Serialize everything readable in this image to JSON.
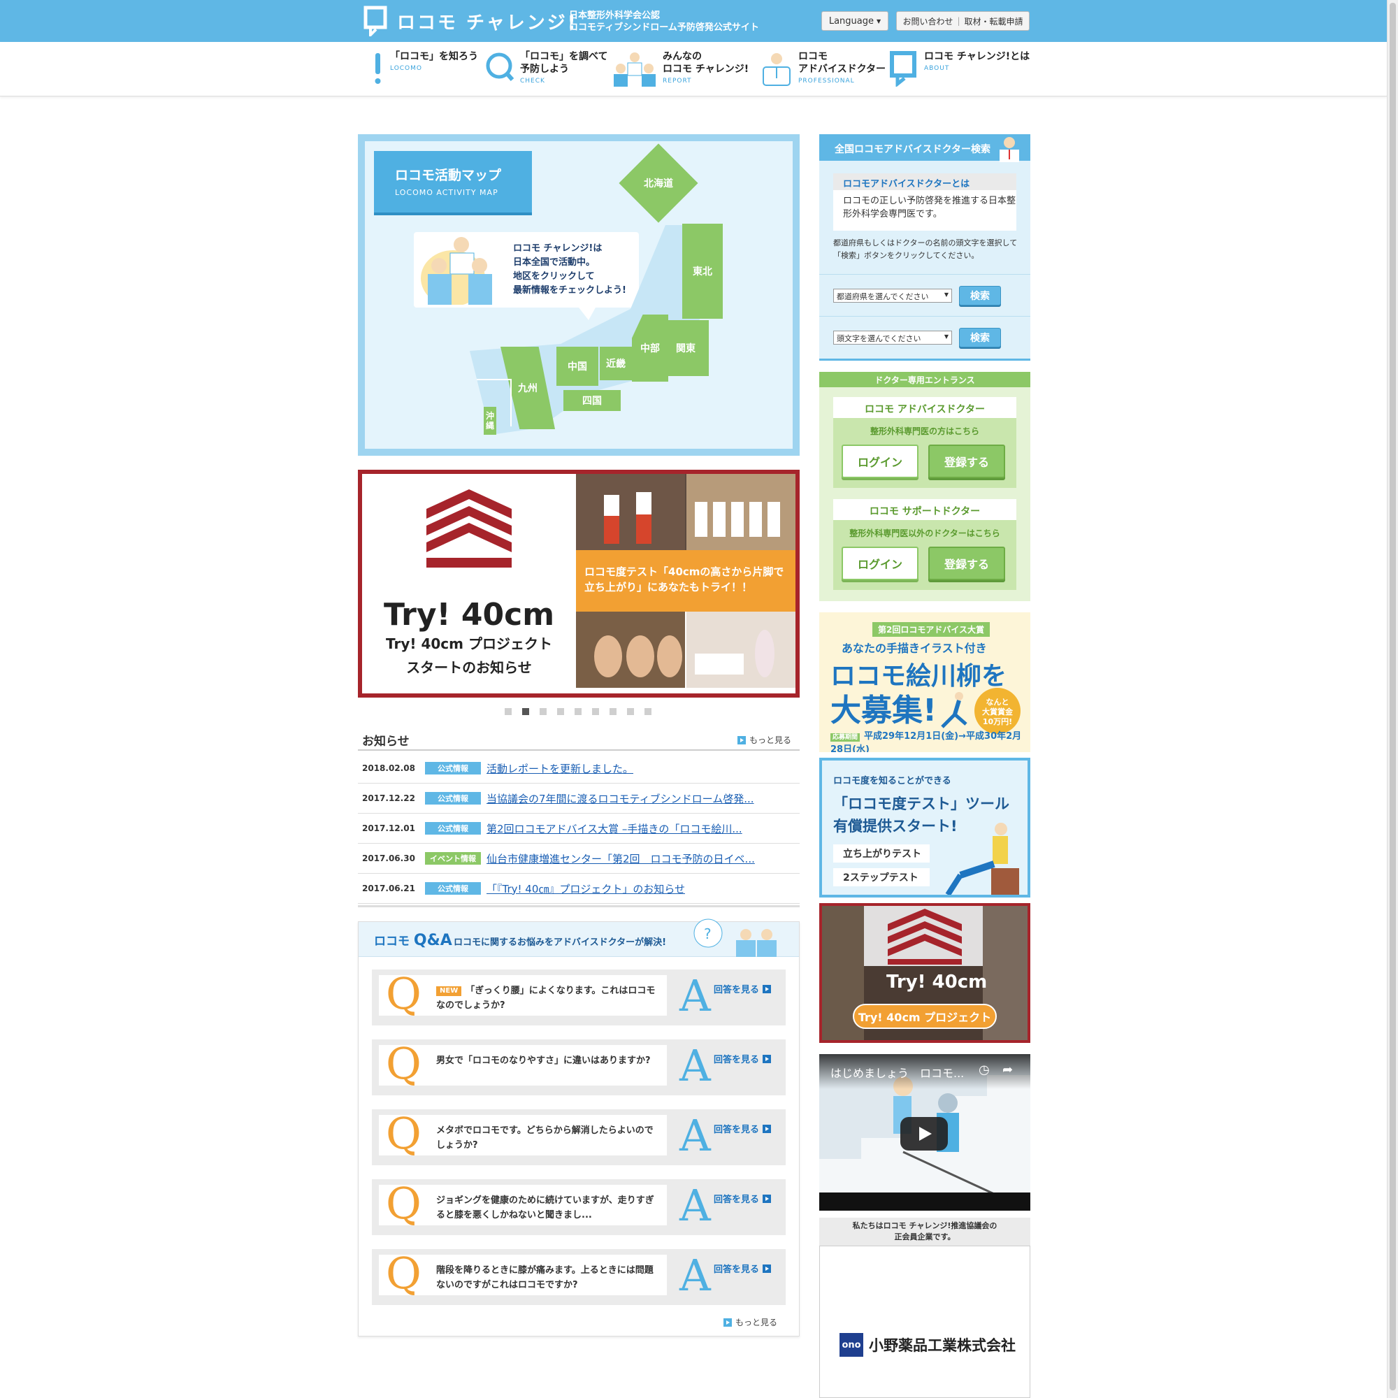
{
  "header": {
    "logo_text": "ロコモ チャレンジ!",
    "tagline_1": "日本整形外科学会公認",
    "tagline_2": "ロコモティブシンドローム予防啓発公式サイト",
    "language_label": "Language",
    "contact_label": "お問い合わせ",
    "press_label": "取材・転載申請"
  },
  "nav": [
    {
      "label": "「ロコモ」を知ろう",
      "sub": "LOCOMO"
    },
    {
      "label": "「ロコモ」を調べて\n予防しよう",
      "sub": "CHECK"
    },
    {
      "label": "みんなの\nロコモ チャレンジ!",
      "sub": "REPORT"
    },
    {
      "label": "ロコモ\nアドバイスドクター",
      "sub": "PROFESSIONAL"
    },
    {
      "label": "ロコモ チャレンジ!とは",
      "sub": "ABOUT"
    }
  ],
  "map": {
    "title": "ロコモ活動マップ",
    "subtitle": "LOCOMO ACTIVITY MAP",
    "speech": "ロコモ チャレンジ!は\n日本全国で活動中。\n地区をクリックして\n最新情報をチェックしよう!",
    "regions": {
      "hokkaido": "北海道",
      "tohoku": "東北",
      "kanto": "関東",
      "chubu": "中部",
      "kinki": "近畿",
      "chugoku": "中国",
      "shikoku": "四国",
      "kyushu": "九州",
      "okinawa": "沖縄"
    }
  },
  "slider": {
    "title": "Try! 40cm",
    "subtitle": "Try! 40cm プロジェクト\nスタートのお知らせ",
    "caption": "ロコモ度テスト「40cmの高さから片脚で\n立ち上がり」にあなたもトライ！！",
    "active_index": 1,
    "dot_count": 9
  },
  "news": {
    "title": "お知らせ",
    "more": "もっと見る",
    "items": [
      {
        "date": "2018.02.08",
        "tag": "公式情報",
        "tag_color": "#5fb7e5",
        "text": "活動レポートを更新しました。"
      },
      {
        "date": "2017.12.22",
        "tag": "公式情報",
        "tag_color": "#5fb7e5",
        "text": "当協議会の7年間に渡るロコモティブシンドローム啓発..."
      },
      {
        "date": "2017.12.01",
        "tag": "公式情報",
        "tag_color": "#5fb7e5",
        "text": "第2回ロコモアドバイス大賞 –手描きの「ロコモ絵川..."
      },
      {
        "date": "2017.06.30",
        "tag": "イベント情報",
        "tag_color": "#8cc866",
        "text": "仙台市健康増進センター「第2回　ロコモ予防の日イベ..."
      },
      {
        "date": "2017.06.21",
        "tag": "公式情報",
        "tag_color": "#5fb7e5",
        "text": "「『Try! 40㎝』プロジェクト」のお知らせ"
      }
    ]
  },
  "qa": {
    "brand_1": "ロコモ",
    "brand_2": "Q&A",
    "subtitle": "ロコモに関するお悩みをアドバイスドクターが解決!",
    "new_label": "NEW",
    "answer_label": "回答を見る",
    "more": "もっと見る",
    "q_mark": "Q",
    "a_mark": "A",
    "items": [
      {
        "text": "「ぎっくり腰」によくなります。これはロコモなのでしょうか?"
      },
      {
        "text": "男女で「ロコモのなりやすさ」に違いはありますか?"
      },
      {
        "text": "メタボでロコモです。どちらから解消したらよいのでしょうか?"
      },
      {
        "text": "ジョギングを健康のために続けていますが、走りすぎると膝を悪くしかねないと聞きまし..."
      },
      {
        "text": "階段を降りるときに膝が痛みます。上るときには問題ないのですがこれはロコモですか?"
      }
    ]
  },
  "sidebar": {
    "search_title": "全国ロコモアドバイスドクター検索",
    "about_title": "ロコモアドバイスドクターとは",
    "about_text": "ロコモの正しい予防啓発を推進する日本整形外科学会専門医です。",
    "note": "都道府県もしくはドクターの名前の頭文字を選択して「検索」ボタンをクリックしてください。",
    "pref_placeholder": "都道府県を選んでください",
    "initial_placeholder": "頭文字を選んでください",
    "search_label": "検索",
    "doctor_entrance": "ドクター専用エントランス",
    "advise_doctor": "ロコモ アドバイスドクター",
    "advise_doctor_sub": "整形外科専門医の方はこちら",
    "support_doctor": "ロコモ サポートドクター",
    "support_doctor_sub": "整形外科専門医以外のドクターはこちら",
    "login": "ログイン",
    "register": "登録する"
  },
  "banners": {
    "senryu_tag": "第2回ロコモアドバイス大賞",
    "senryu_1": "あなたの手描きイラスト付き",
    "senryu_2": "ロコモ絵川柳を",
    "senryu_3": "大募集!",
    "senryu_prize": "なんと\n大賞賞金\n10万円!",
    "senryu_term_label": "応募期間",
    "senryu_term": "平成29年12月1日(金)→平成30年2月28日(水)",
    "test_1": "ロコモ度を知ることができる",
    "test_2": "「ロコモ度テスト」ツール\n有償提供スタート!",
    "test_pill_1": "立ち上がりテスト",
    "test_pill_2": "2ステップテスト",
    "try_logo": "Try! 40cm",
    "try_button": "Try! 40cm プロジェクト"
  },
  "video": {
    "title": "はじめましょう　ロコモ..."
  },
  "sponsor": {
    "heading": "私たちはロコモ チャレンジ!推進協議会の\n正会員企業です。",
    "mark": "ono",
    "name": "小野薬品工業株式会社"
  }
}
